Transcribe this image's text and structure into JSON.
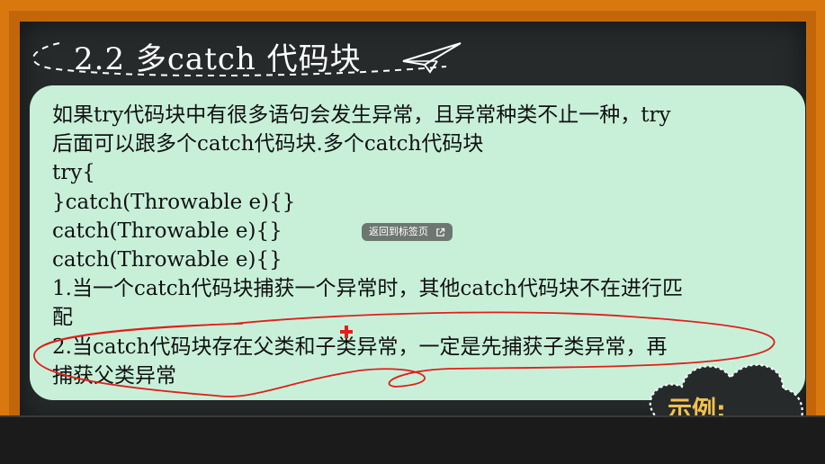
{
  "slide": {
    "title": "2.2 多catch 代码块",
    "lines": [
      "如果try代码块中有很多语句会发生异常，且异常种类不止一种，try",
      "后面可以跟多个catch代码块.多个catch代码块",
      "try{",
      "}catch(Throwable e){}",
      "catch(Throwable e){}",
      "catch(Throwable e){}",
      "1.当一个catch代码块捕获一个异常时，其他catch代码块不在进行匹",
      "配",
      "2.当catch代码块存在父类和子类异常，一定是先捕获子类异常，再",
      "捕获父类异常"
    ],
    "example_label": "示例:"
  },
  "overlay": {
    "back_to_tab_label": "返回到标签页"
  },
  "icons": {
    "plane": "paper-plane-icon",
    "external": "external-link-icon",
    "cursor": "red-cross-cursor-icon"
  },
  "colors": {
    "frame": "#d9780e",
    "board": "#262a2b",
    "panel": "#c8f0d9",
    "annotation": "#e0201a",
    "example": "#f2c14e"
  }
}
